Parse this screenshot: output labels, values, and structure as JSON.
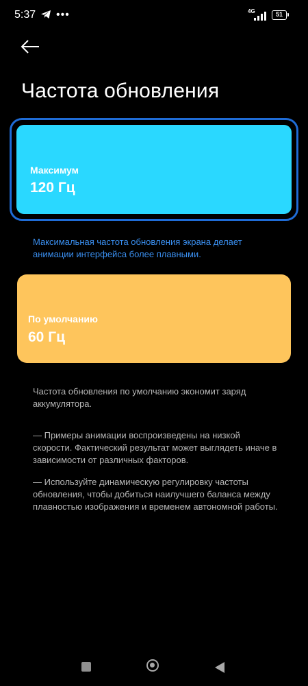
{
  "status_bar": {
    "time": "5:37",
    "network": "4G",
    "battery": "51",
    "icons": [
      "telegram-icon",
      "more-dots-icon",
      "signal-icon",
      "battery-icon"
    ]
  },
  "header": {
    "title": "Частота обновления",
    "back_icon": "arrow-left-icon"
  },
  "options": [
    {
      "label": "Максимум",
      "value": "120 Гц",
      "color": "#2ad8ff",
      "selected": true,
      "description": "Максимальная частота обновления экрана делает анимации интерфейса более плавными."
    },
    {
      "label": "По умолчанию",
      "value": "60 Гц",
      "color": "#fec55c",
      "selected": false,
      "description": "Частота обновления по умолчанию экономит заряд аккумулятора."
    }
  ],
  "notes": [
    "— Примеры анимации воспроизведены на низкой скорости. Фактический результат может выглядеть иначе в зависимости от различных факторов.",
    "— Используйте динамическую регулировку частоты обновления, чтобы добиться наилучшего баланса между плавностью изображения и временем автономной работы."
  ],
  "colors": {
    "background": "#000000",
    "accent_blue": "#3a8ff0",
    "selection_border": "#1f6cd6",
    "secondary_text": "#b7b7b7"
  },
  "nav_bar": {
    "icons": [
      "recents-square-icon",
      "home-circle-icon",
      "back-triangle-icon"
    ]
  }
}
